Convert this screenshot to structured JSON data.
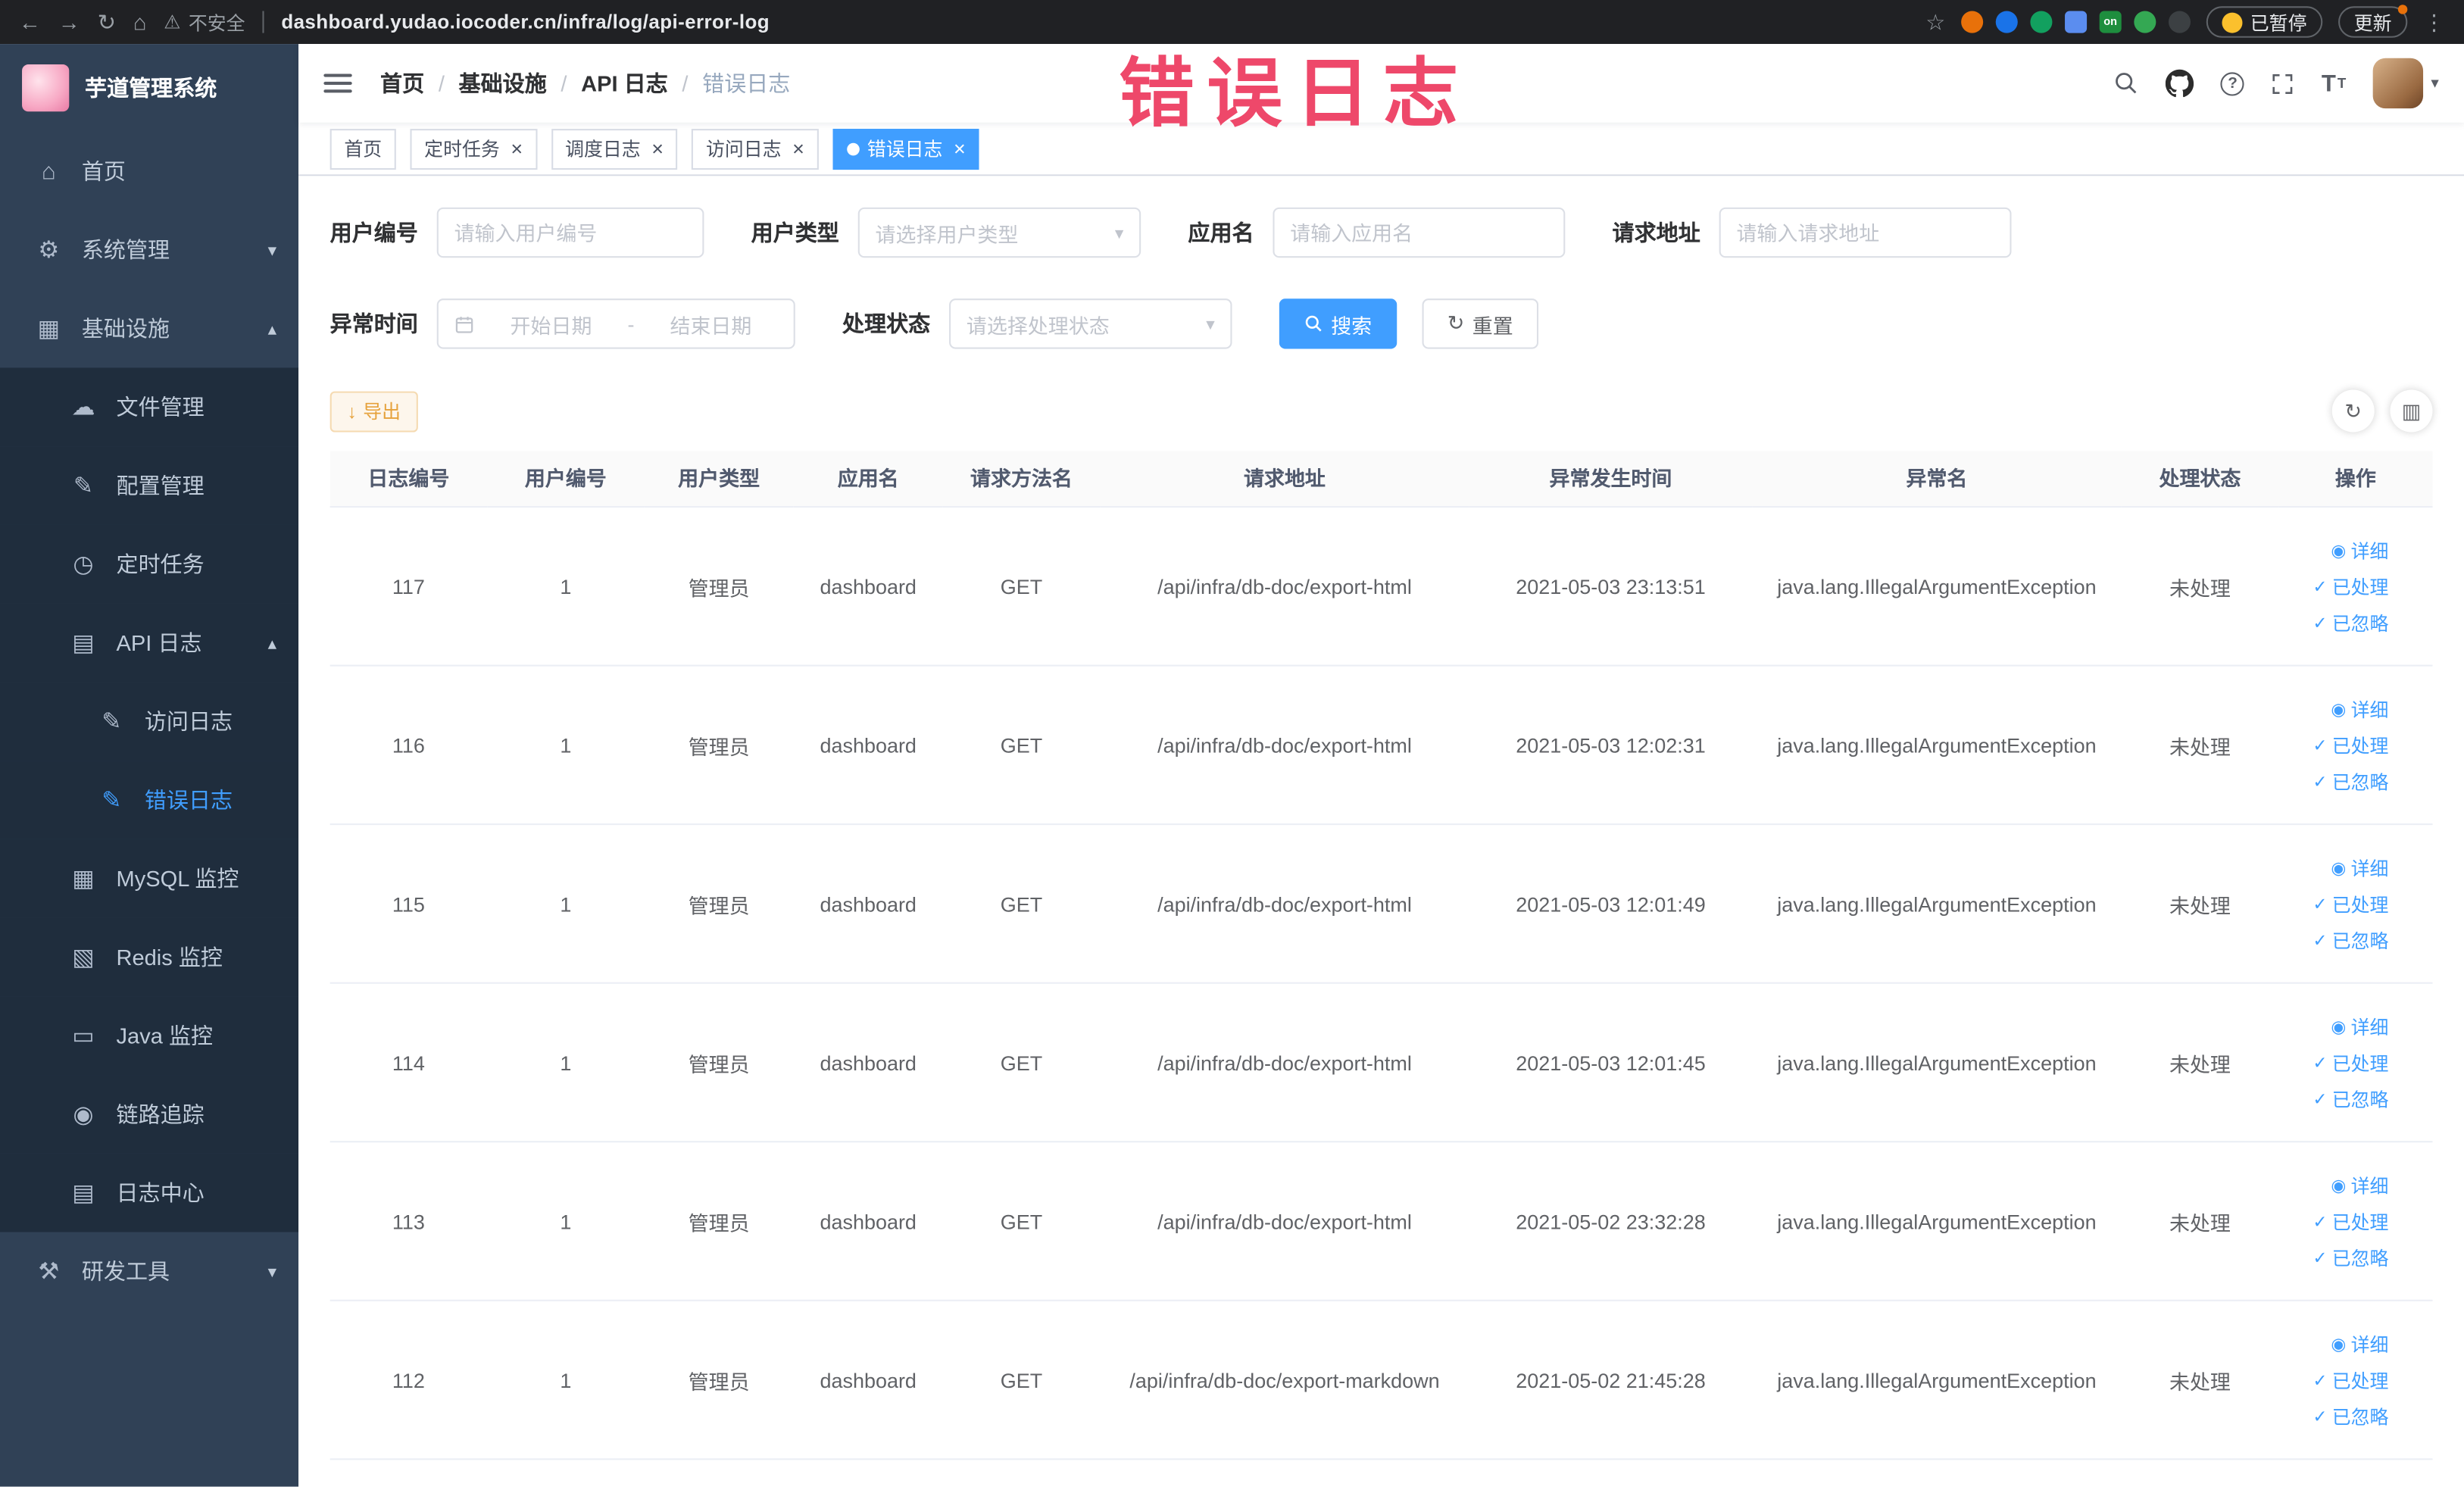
{
  "colors": {
    "accent": "#409eff",
    "annotation": "#ee3f63",
    "sidebar_bg": "#304156",
    "submenu_bg": "#1f2d3d",
    "warning": "#e6a23c"
  },
  "icons": {
    "home-icon": "⌂",
    "gear-icon": "⚙",
    "grid-icon": "▦",
    "cloud-icon": "☁",
    "edit-icon": "✎",
    "clock-icon": "◷",
    "doc-icon": "▤",
    "table-icon": "▦",
    "layers-icon": "▧",
    "monitor-icon": "▭",
    "eye-icon": "◉",
    "tool-icon": "⚒",
    "check-icon": "✓",
    "refresh-icon": "↻",
    "download-icon": "↓",
    "columns-icon": "▥",
    "caret-down-icon": "▾",
    "chevron-up-icon": "▴",
    "chevron-down-icon": "▾",
    "star-icon": "☆",
    "warning-icon": "⚠",
    "back-icon": "←",
    "forward-icon": "→",
    "reload-icon": "↻",
    "kebab-icon": "⋮",
    "close-icon": "×"
  },
  "annotation": {
    "text": "错误日志"
  },
  "browser": {
    "security_label": "不安全",
    "url": "dashboard.yudao.iocoder.cn/infra/log/api-error-log",
    "paused_button": "已暂停",
    "update_button": "更新",
    "extensions": [
      {
        "color": "#e8710a",
        "shape": "circle"
      },
      {
        "color": "#1a73e8",
        "shape": "circle"
      },
      {
        "color": "#12a05f",
        "shape": "circle"
      },
      {
        "color": "#5b8def",
        "shape": "square"
      },
      {
        "color": "#1e8e3e",
        "shape": "square",
        "label": "on"
      },
      {
        "color": "#34a853",
        "shape": "circle"
      },
      {
        "color": "#3c4043",
        "shape": "circle"
      }
    ]
  },
  "sidebar": {
    "logo_title": "芋道管理系统",
    "items": [
      {
        "key": "home",
        "label": "首页",
        "level": 0,
        "icon": "home-icon"
      },
      {
        "key": "system",
        "label": "系统管理",
        "level": 0,
        "icon": "gear-icon",
        "arrow": "down"
      },
      {
        "key": "infra",
        "label": "基础设施",
        "level": 0,
        "icon": "grid-icon",
        "arrow": "up"
      },
      {
        "key": "file",
        "label": "文件管理",
        "level": 1,
        "icon": "cloud-icon"
      },
      {
        "key": "config",
        "label": "配置管理",
        "level": 1,
        "icon": "edit-icon"
      },
      {
        "key": "job",
        "label": "定时任务",
        "level": 1,
        "icon": "clock-icon"
      },
      {
        "key": "api-log",
        "label": "API 日志",
        "level": 1,
        "icon": "doc-icon",
        "arrow": "up"
      },
      {
        "key": "access-log",
        "label": "访问日志",
        "level": 2,
        "icon": "edit-icon"
      },
      {
        "key": "error-log",
        "label": "错误日志",
        "level": 2,
        "icon": "edit-icon",
        "active": true
      },
      {
        "key": "mysql",
        "label": "MySQL 监控",
        "level": 1,
        "icon": "table-icon"
      },
      {
        "key": "redis",
        "label": "Redis 监控",
        "level": 1,
        "icon": "layers-icon"
      },
      {
        "key": "java",
        "label": "Java 监控",
        "level": 1,
        "icon": "monitor-icon"
      },
      {
        "key": "trace",
        "label": "链路追踪",
        "level": 1,
        "icon": "eye-icon"
      },
      {
        "key": "log-center",
        "label": "日志中心",
        "level": 1,
        "icon": "doc-icon"
      },
      {
        "key": "dev-tools",
        "label": "研发工具",
        "level": 0,
        "icon": "tool-icon",
        "arrow": "down"
      }
    ]
  },
  "breadcrumb": [
    "首页",
    "基础设施",
    "API 日志",
    "错误日志"
  ],
  "tabs": [
    {
      "key": "home",
      "label": "首页",
      "closable": false,
      "active": false
    },
    {
      "key": "job",
      "label": "定时任务",
      "closable": true,
      "active": false
    },
    {
      "key": "job-log",
      "label": "调度日志",
      "closable": true,
      "active": false
    },
    {
      "key": "access-log",
      "label": "访问日志",
      "closable": true,
      "active": false
    },
    {
      "key": "error-log",
      "label": "错误日志",
      "closable": true,
      "active": true
    }
  ],
  "filters": {
    "user_id": {
      "label": "用户编号",
      "placeholder": "请输入用户编号"
    },
    "user_type": {
      "label": "用户类型",
      "placeholder": "请选择用户类型"
    },
    "app_name": {
      "label": "应用名",
      "placeholder": "请输入应用名"
    },
    "request_url": {
      "label": "请求地址",
      "placeholder": "请输入请求地址"
    },
    "exception_time": {
      "label": "异常时间",
      "start_placeholder": "开始日期",
      "separator": "-",
      "end_placeholder": "结束日期"
    },
    "process_status": {
      "label": "处理状态",
      "placeholder": "请选择处理状态"
    },
    "search_label": "搜索",
    "reset_label": "重置"
  },
  "toolbar": {
    "export_label": "导出"
  },
  "table": {
    "columns": [
      "日志编号",
      "用户编号",
      "用户类型",
      "应用名",
      "请求方法名",
      "请求地址",
      "异常发生时间",
      "异常名",
      "处理状态",
      "操作"
    ],
    "actions": [
      "详细",
      "已处理",
      "已忽略"
    ],
    "rows": [
      {
        "id": "117",
        "user_id": "1",
        "user_type": "管理员",
        "app": "dashboard",
        "method": "GET",
        "url": "/api/infra/db-doc/export-html",
        "time": "2021-05-03 23:13:51",
        "exception": "java.lang.IllegalArgumentException",
        "status": "未处理"
      },
      {
        "id": "116",
        "user_id": "1",
        "user_type": "管理员",
        "app": "dashboard",
        "method": "GET",
        "url": "/api/infra/db-doc/export-html",
        "time": "2021-05-03 12:02:31",
        "exception": "java.lang.IllegalArgumentException",
        "status": "未处理"
      },
      {
        "id": "115",
        "user_id": "1",
        "user_type": "管理员",
        "app": "dashboard",
        "method": "GET",
        "url": "/api/infra/db-doc/export-html",
        "time": "2021-05-03 12:01:49",
        "exception": "java.lang.IllegalArgumentException",
        "status": "未处理"
      },
      {
        "id": "114",
        "user_id": "1",
        "user_type": "管理员",
        "app": "dashboard",
        "method": "GET",
        "url": "/api/infra/db-doc/export-html",
        "time": "2021-05-03 12:01:45",
        "exception": "java.lang.IllegalArgumentException",
        "status": "未处理"
      },
      {
        "id": "113",
        "user_id": "1",
        "user_type": "管理员",
        "app": "dashboard",
        "method": "GET",
        "url": "/api/infra/db-doc/export-html",
        "time": "2021-05-02 23:32:28",
        "exception": "java.lang.IllegalArgumentException",
        "status": "未处理"
      },
      {
        "id": "112",
        "user_id": "1",
        "user_type": "管理员",
        "app": "dashboard",
        "method": "GET",
        "url": "/api/infra/db-doc/export-markdown",
        "time": "2021-05-02 21:45:28",
        "exception": "java.lang.IllegalArgumentException",
        "status": "未处理"
      }
    ]
  }
}
